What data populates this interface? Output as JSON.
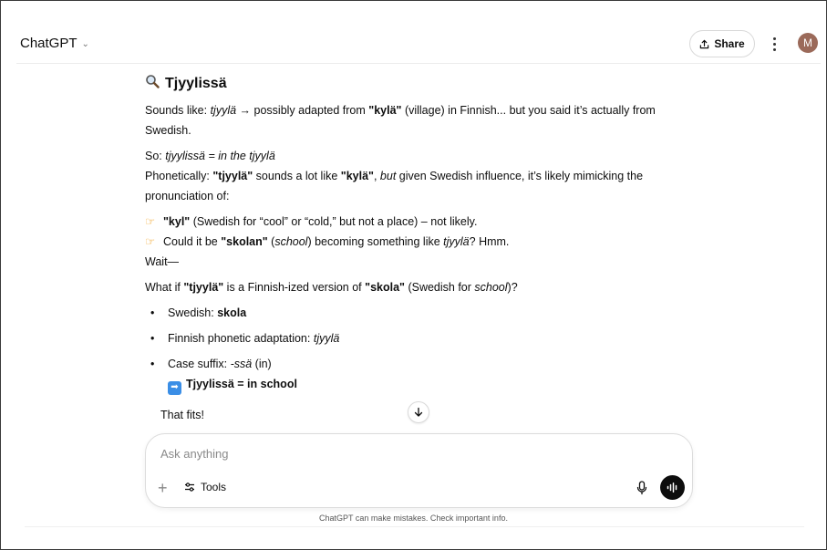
{
  "header": {
    "model_label": "ChatGPT",
    "share_label": "Share",
    "avatar_initial": "M"
  },
  "message": {
    "heading_icon": "magnifying-glass-icon",
    "heading": "Tjyylissä",
    "p1_a": "Sounds like: ",
    "p1_b": "tjyylä",
    "p1_c": " → possibly adapted from ",
    "p1_d": "\"kylä\"",
    "p1_e": " (village) in Finnish... but you said it’s actually from Swedish.",
    "p2_a": "So: ",
    "p2_b": "tjyylissä = in the tjyylä",
    "p3_a": "Phonetically: ",
    "p3_b": "\"tjyylä\"",
    "p3_c": " sounds a lot like ",
    "p3_d": "\"kylä\"",
    "p3_e": ", ",
    "p3_f": "but",
    "p3_g": " given Swedish influence, it’s likely mimicking the pronunciation of:",
    "h1_a": "\"kyl\"",
    "h1_b": " (Swedish for “cool” or “cold,” but not a place) – not likely.",
    "h2_a": "Could it be ",
    "h2_b": "\"skolan\"",
    "h2_c": " (",
    "h2_d": "school",
    "h2_e": ") becoming something like ",
    "h2_f": "tjyylä",
    "h2_g": "? Hmm.",
    "wait": "Wait—",
    "p4_a": "What if ",
    "p4_b": "\"tjyylä\"",
    "p4_c": " is a Finnish-ized version of ",
    "p4_d": "\"skola\"",
    "p4_e": " (Swedish for ",
    "p4_f": "school",
    "p4_g": ")?",
    "b1_a": "Swedish: ",
    "b1_b": "skola",
    "b2_a": "Finnish phonetic adaptation: ",
    "b2_b": "tjyylä",
    "b3_a": "Case suffix: ",
    "b3_b": "-ssä",
    "b3_c": " (in)",
    "b3_result": "Tjyylissä = in school",
    "fits": "That fits!"
  },
  "composer": {
    "placeholder": "Ask anything",
    "tools_label": "Tools"
  },
  "footer": {
    "disclaimer": "ChatGPT can make mistakes. Check important info."
  }
}
